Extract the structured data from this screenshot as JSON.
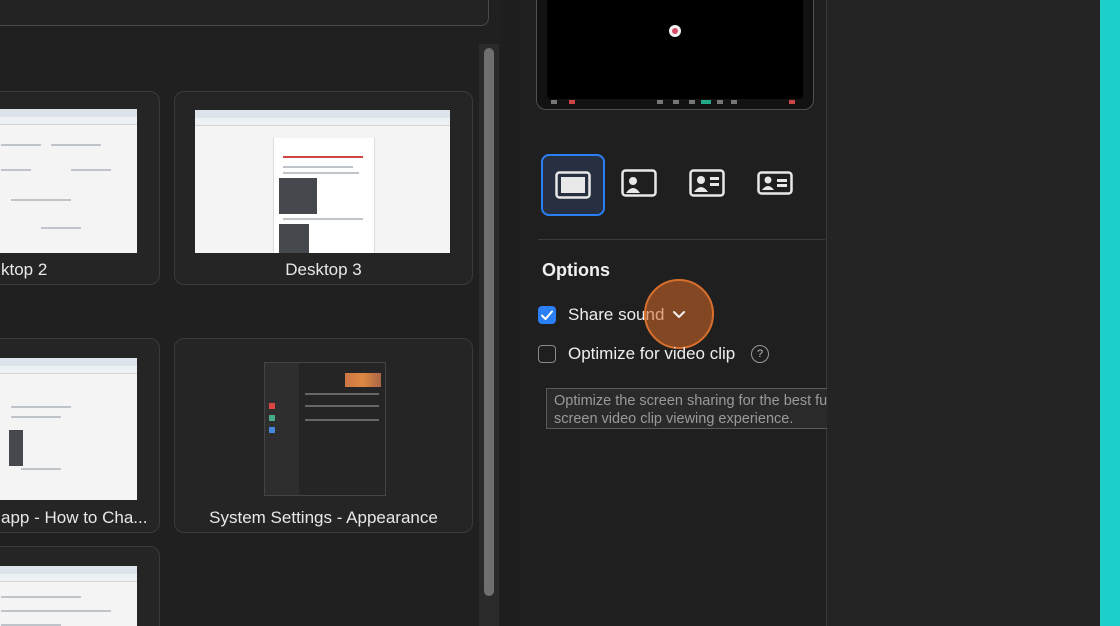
{
  "tiles": {
    "desktop2": {
      "label": "ktop 2"
    },
    "desktop3": {
      "label": "Desktop 3"
    },
    "app": {
      "label": "app - How to Cha..."
    },
    "system_settings": {
      "label": "System Settings - Appearance"
    }
  },
  "options": {
    "title": "Options",
    "share_sound": {
      "label": "Share sound",
      "checked": true
    },
    "optimize_video": {
      "label": "Optimize for video clip",
      "checked": false
    },
    "tooltip": "Optimize the screen sharing for the best full-screen video clip viewing experience.",
    "help_glyph": "?"
  },
  "layout_buttons": [
    "screen-only-icon",
    "picture-in-picture-icon",
    "presenter-left-icon",
    "presenter-card-icon"
  ],
  "colors": {
    "accent": "#2a7ff5",
    "cursor": "#d96f2c",
    "edge": "#1ccfc8"
  }
}
